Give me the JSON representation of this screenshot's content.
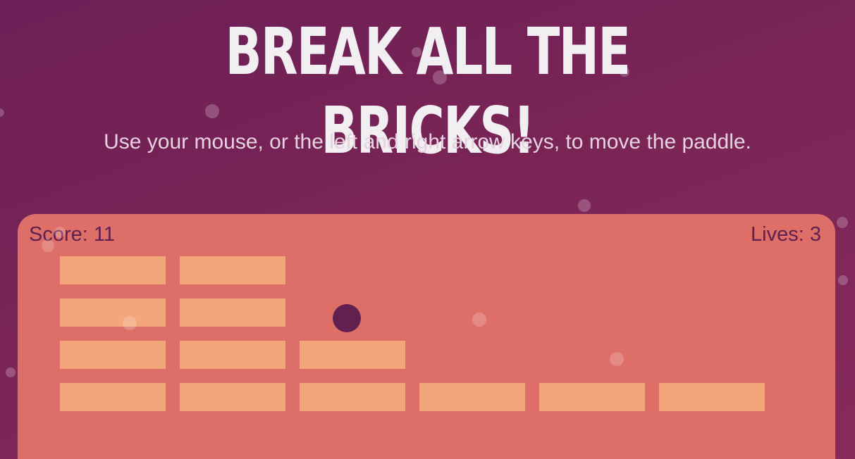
{
  "title": "BREAK ALL THE BRICKS!",
  "instructions": "Use your mouse, or the left and right arrow keys, to move the paddle.",
  "hud": {
    "score_text": "Score: 11",
    "lives_text": "Lives: 3"
  },
  "colors": {
    "background": "#7a2456",
    "canvas": "#de6e68",
    "brick": "#f2a67a",
    "ball": "#61204e",
    "hud_text": "#61204e",
    "title_text": "#f1eff1"
  }
}
